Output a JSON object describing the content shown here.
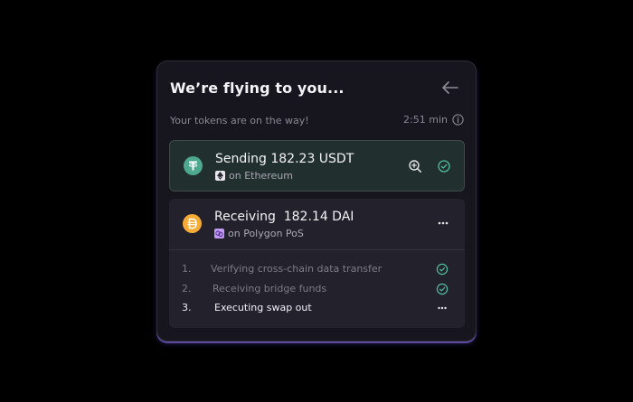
{
  "header": {
    "title": "We’re flying to you...",
    "subtitle": "Your tokens are on the way!",
    "eta": "2:51 min",
    "back_icon": "arrow-left-icon",
    "info_icon": "info-icon"
  },
  "sending": {
    "text": "Sending 182.23 USDT",
    "chain": "on Ethereum",
    "token_icon": "usdt-icon",
    "chain_icon": "ethereum-icon",
    "actions": [
      "zoom-in-icon",
      "check-circle-icon"
    ]
  },
  "receiving": {
    "text": "Receiving  182.14 DAI",
    "chain": "on Polygon PoS",
    "token_icon": "dai-icon",
    "chain_icon": "polygon-icon",
    "menu_icon": "more-horizontal-icon"
  },
  "steps": [
    {
      "num": "1.",
      "label": "Verifying cross-chain data transfer",
      "status": "done"
    },
    {
      "num": "2.",
      "label": "Receiving bridge funds",
      "status": "done"
    },
    {
      "num": "3.",
      "label": "Executing swap out",
      "status": "pending"
    }
  ],
  "colors": {
    "background": "#000000",
    "card": "#17151d",
    "send_box": "#212f2e",
    "recv_box": "#23212b",
    "usdt": "#4ea88f",
    "dai": "#f5ac37",
    "success": "#4fbe9e",
    "glow": "#8a6cff"
  }
}
